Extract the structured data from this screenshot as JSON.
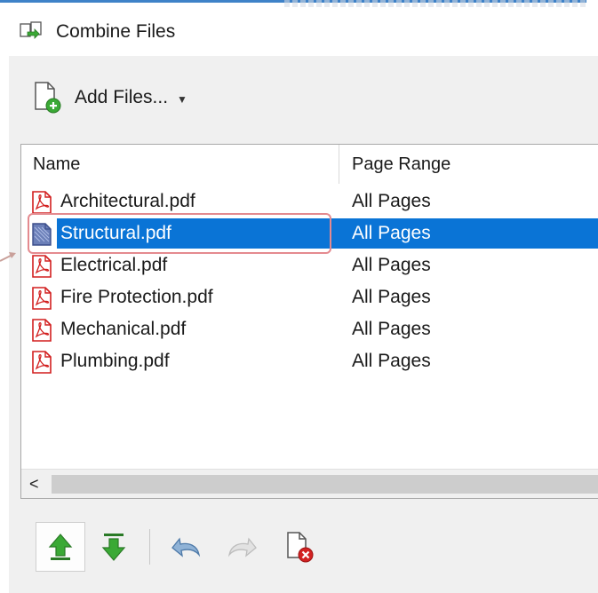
{
  "window": {
    "title": "Combine Files",
    "icon": "combine-files-icon"
  },
  "toolbar_top": {
    "add_files_label": "Add Files...",
    "add_files_icon": "add-file-icon",
    "dropdown_icon": "caret-down-icon"
  },
  "file_list": {
    "columns": [
      "Name",
      "Page Range"
    ],
    "rows": [
      {
        "name": "Architectural.pdf",
        "page_range": "All Pages",
        "selected": false
      },
      {
        "name": "Structural.pdf",
        "page_range": "All Pages",
        "selected": true
      },
      {
        "name": "Electrical.pdf",
        "page_range": "All Pages",
        "selected": false
      },
      {
        "name": "Fire Protection.pdf",
        "page_range": "All Pages",
        "selected": false
      },
      {
        "name": "Mechanical.pdf",
        "page_range": "All Pages",
        "selected": false
      },
      {
        "name": "Plumbing.pdf",
        "page_range": "All Pages",
        "selected": false
      }
    ],
    "scroll_left_glyph": "<"
  },
  "toolbar_bottom": {
    "buttons": [
      {
        "icon": "move-up-icon",
        "active": true
      },
      {
        "icon": "move-down-icon",
        "active": false
      },
      {
        "icon": "undo-icon",
        "active": false
      },
      {
        "icon": "redo-icon",
        "active": false,
        "disabled": true
      },
      {
        "icon": "remove-file-icon",
        "active": false
      }
    ]
  },
  "colors": {
    "selection": "#0a74d6",
    "highlight": "#e48a8f",
    "panel": "#f0f0f0",
    "pdf_red": "#d21f1f",
    "arrow_green": "#3aa935"
  }
}
